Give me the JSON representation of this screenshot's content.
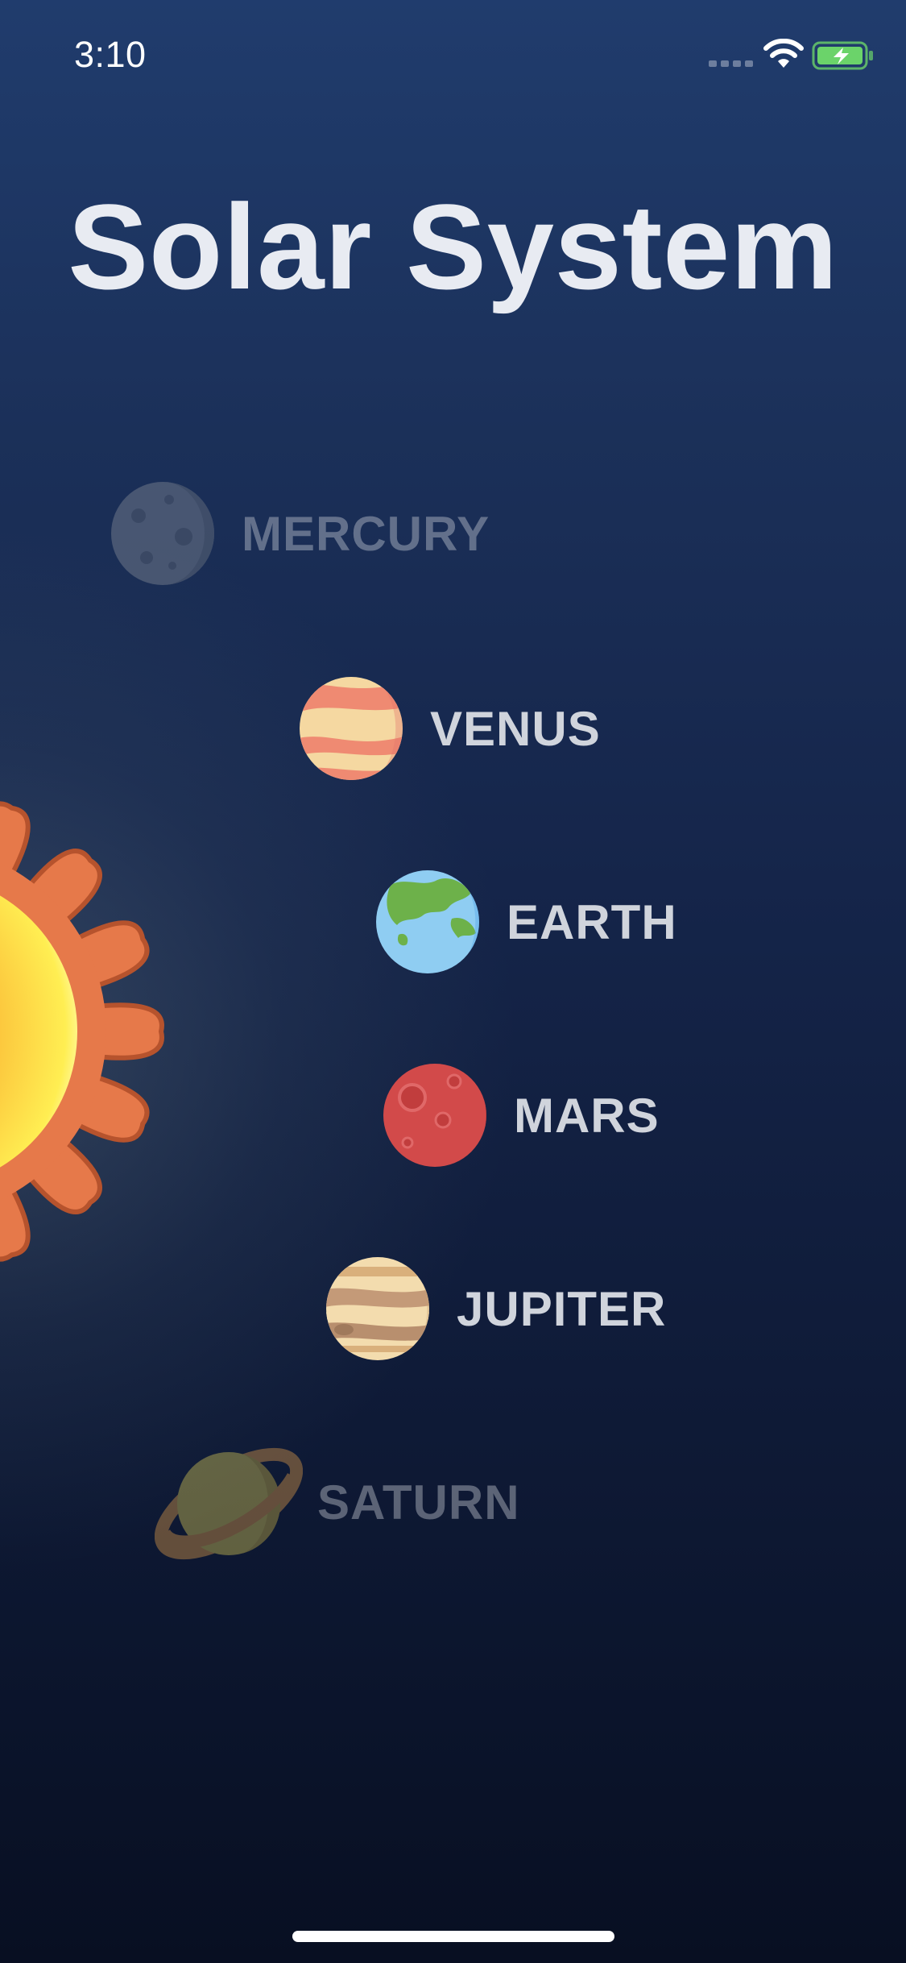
{
  "status_bar": {
    "time": "3:10",
    "icons": [
      "cellular-signal-icon",
      "wifi-icon",
      "battery-charging-icon"
    ],
    "battery_color": "#6bd36a"
  },
  "title": "Solar System",
  "colors": {
    "background_top": "#203c6d",
    "background_bottom": "#080f22",
    "title": "#e8ebf2",
    "label": "#d0d4dc",
    "sun_corona": "#e6794a",
    "sun_core": "#ffe94d"
  },
  "planets": [
    {
      "name": "MERCURY",
      "icon": "mercury-icon",
      "dimmed": true
    },
    {
      "name": "VENUS",
      "icon": "venus-icon",
      "dimmed": false
    },
    {
      "name": "EARTH",
      "icon": "earth-icon",
      "dimmed": false
    },
    {
      "name": "MARS",
      "icon": "mars-icon",
      "dimmed": false
    },
    {
      "name": "JUPITER",
      "icon": "jupiter-icon",
      "dimmed": false
    },
    {
      "name": "SATURN",
      "icon": "saturn-icon",
      "dimmed": true
    }
  ]
}
